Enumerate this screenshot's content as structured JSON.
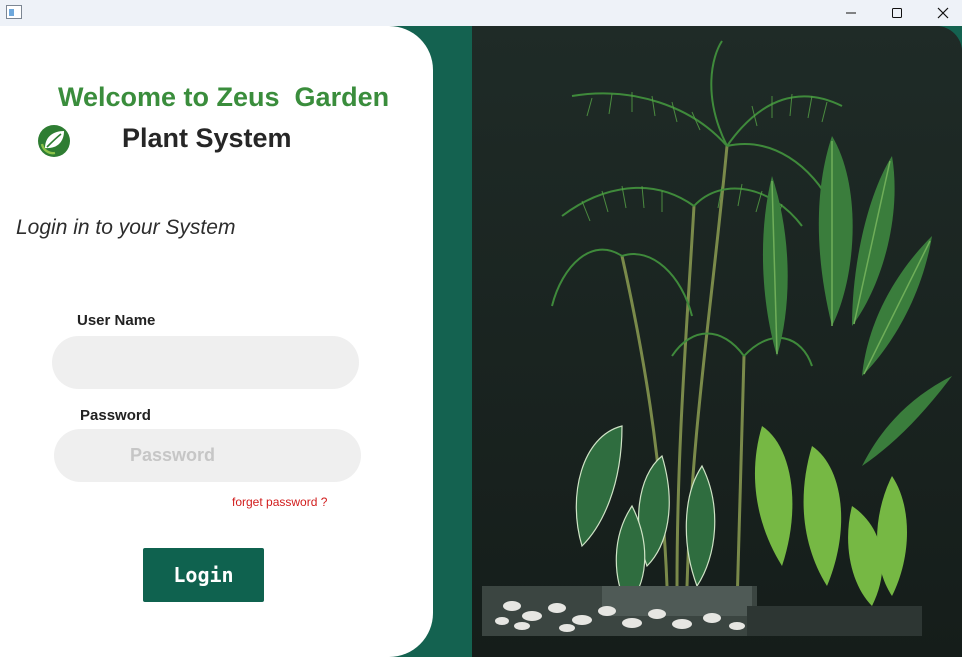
{
  "window": {
    "minimize_glyph": "—",
    "maximize_glyph": "☐",
    "close_glyph": "✕"
  },
  "login": {
    "welcome_title": "Welcome to Zeus  Garden",
    "subtitle": "Plant System",
    "prompt": "Login in to your System",
    "username_label": "User Name",
    "username_value": "",
    "password_label": "Password",
    "password_placeholder": "Password",
    "forget_link": "forget password ?",
    "login_button": "Login"
  },
  "icons": {
    "logo": "leaf-logo-icon",
    "app": "app-window-icon",
    "image": "indoor-plants-image"
  },
  "colors": {
    "brand_green": "#146250",
    "title_green": "#3a8d3c",
    "link_red": "#d11c1c",
    "field_bg": "#efefef"
  }
}
